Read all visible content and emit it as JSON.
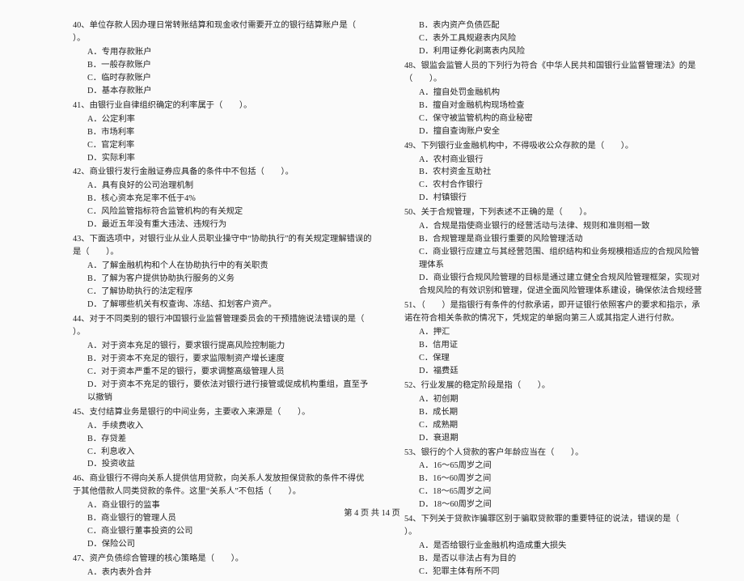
{
  "footer": "第 4 页 共 14 页",
  "left": [
    {
      "n": "40",
      "stem": "单位存款人因办理日常转账结算和现金收付需要开立的银行结算账户是（　　）。",
      "opts": [
        "A．专用存款账户",
        "B．一般存款账户",
        "C．临时存款账户",
        "D．基本存款账户"
      ]
    },
    {
      "n": "41",
      "stem": "由银行业自律组织确定的利率属于（　　）。",
      "opts": [
        "A．公定利率",
        "B．市场利率",
        "C．官定利率",
        "D．实际利率"
      ]
    },
    {
      "n": "42",
      "stem": "商业银行发行金融证券应具备的条件中不包括（　　）。",
      "opts": [
        "A．具有良好的公司治理机制",
        "B．核心资本充足率不低于4%",
        "C．风险监管指标符合监管机构的有关规定",
        "D．最近五年没有重大违法、违规行为"
      ]
    },
    {
      "n": "43",
      "stem": "下面选项中，对银行业从业人员职业操守中“协助执行”的有关规定理解错误的是（　　）。",
      "opts": [
        "A．了解金融机构和个人在协助执行中的有关职责",
        "B．了解为客户提供协助执行服务的义务",
        "C．了解协助执行的法定程序",
        "D．了解哪些机关有权查询、冻结、扣划客户资产。"
      ]
    },
    {
      "n": "44",
      "stem": "对于不同类别的银行冲国银行业监督管理委员会的干预措施说法错误的是（　　）。",
      "opts": [
        "A．对于资本充足的银行，要求银行提高风险控制能力",
        "B．对于资本不充足的银行，要求监限制资产增长速度",
        "C．对于资本严重不足的银行，要求调整高级管理人员",
        "D．对于资本不充足的银行，要依法对银行进行接管或促成机构重组，直至予以撤销"
      ]
    },
    {
      "n": "45",
      "stem": "支付结算业务是银行的中间业务，主要收入来源是（　　）。",
      "opts": [
        "A．手续费收入",
        "B．存贷差",
        "C．利息收入",
        "D．投资收益"
      ]
    },
    {
      "n": "46",
      "stem": "商业银行不得向关系人提供信用贷款，向关系人发放担保贷款的条件不得优于其他借款人同类贷款的条件。这里“关系人”不包括（　　）。",
      "opts": [
        "A．商业银行的监事",
        "B．商业银行的管理人员",
        "C．商业银行董事投资的公司",
        "D．保险公司"
      ]
    },
    {
      "n": "47",
      "stem": "资产负债综合管理的核心策略是（　　）。",
      "opts": [
        "A．表内表外合并"
      ]
    }
  ],
  "right_pre_opts": [
    "B．表内资产负债匹配",
    "C．表外工具规避表内风险",
    "D．利用证券化剥离表内风险"
  ],
  "right": [
    {
      "n": "48",
      "stem": "银监会监管人员的下列行为符合《中华人民共和国银行业监督管理法》的是（　　）。",
      "opts": [
        "A．擅自处罚金融机构",
        "B．擅自对金融机构现场检查",
        "C．保守被监管机构的商业秘密",
        "D．擅自查询账户安全"
      ]
    },
    {
      "n": "49",
      "stem": "下列银行业金融机构中，不得吸收公众存款的是（　　）。",
      "opts": [
        "A．农村商业银行",
        "B．农村资金互助社",
        "C．农村合作银行",
        "D．村镇银行"
      ]
    },
    {
      "n": "50",
      "stem": "关于合规管理，下列表述不正确的是（　　）。",
      "opts": [
        "A．合规是指使商业银行的经营活动与法律、规则和准则相一致",
        "B．合规管理是商业银行重要的风险管理活动",
        "C．商业银行应建立与其经营范围、组织结构和业务规模相适应的合规风险管理体系",
        "D．商业银行合规风险管理的目标是通过建立健全合规风险管理框架，实现对合规风险的有效识别和管理，促进全面风险管理体系建设，确保依法合规经营"
      ]
    },
    {
      "n": "51",
      "stem": "（　　）是指银行有条件的付款承诺，即开证银行依照客户的要求和指示，承诺在符合相关条款的情况下，凭规定的单据向第三人或其指定人进行付款。",
      "opts": [
        "A．押汇",
        "B．信用证",
        "C．保理",
        "D．福费廷"
      ]
    },
    {
      "n": "52",
      "stem": "行业发展的稳定阶段是指（　　）。",
      "opts": [
        "A．初创期",
        "B．成长期",
        "C．成熟期",
        "D．衰退期"
      ]
    },
    {
      "n": "53",
      "stem": "银行的个人贷款的客户年龄应当在（　　）。",
      "opts": [
        "A．16～65周岁之间",
        "B．16～60周岁之间",
        "C．18～65周岁之间",
        "D．18～60周岁之间"
      ]
    },
    {
      "n": "54",
      "stem": "下列关于贷款诈骗罪区别于骗取贷款罪的重要特征的说法，错误的是（　　）。",
      "opts": [
        "A．是否给银行业金融机构造成重大损失",
        "B．是否以非法占有为目的",
        "C．犯罪主体有所不同"
      ]
    }
  ]
}
